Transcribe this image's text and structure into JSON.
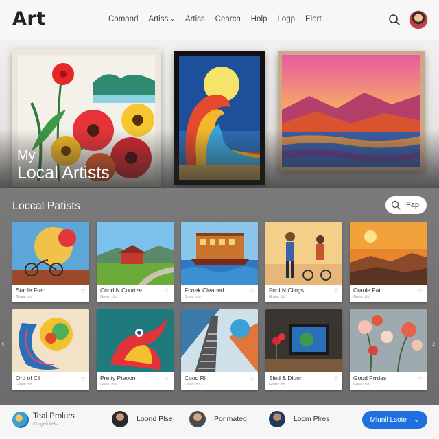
{
  "header": {
    "logo": "Art",
    "nav": [
      {
        "label": "Comand"
      },
      {
        "label": "Artiss",
        "has_dropdown": true
      },
      {
        "label": "Artiss"
      },
      {
        "label": "Cearch"
      },
      {
        "label": "Holp"
      },
      {
        "label": "Logp"
      },
      {
        "label": "Elort"
      }
    ],
    "search_icon": "search-icon",
    "avatar": "user-avatar"
  },
  "hero": {
    "title_line1": "My",
    "title_line2": "Local Artists",
    "artworks": [
      "flowers-painting",
      "wave-moon-painting",
      "sunset-mountains-painting"
    ]
  },
  "section": {
    "title": "Loccal Patists",
    "filter_label": "Fap",
    "cards": [
      {
        "title": "Stacle Fred",
        "subtitle": "Gnea: clo"
      },
      {
        "title": "Cood N Courtze",
        "subtitle": "Gnea: clo"
      },
      {
        "title": "Fooek Cleaned",
        "subtitle": "Gnea: clo"
      },
      {
        "title": "Fnol N Cilogs",
        "subtitle": "Gnea: clo"
      },
      {
        "title": "Craole Fat",
        "subtitle": "Gnea: clo"
      },
      {
        "title": "Ord of Cil",
        "subtitle": "Gnea: clo"
      },
      {
        "title": "Pretty Pteoon",
        "subtitle": "Gnea: clo"
      },
      {
        "title": "Cood Ril",
        "subtitle": "Gnea: clo"
      },
      {
        "title": "Sied & Diuon",
        "subtitle": "Gnea: clo"
      },
      {
        "title": "Good Prrdes",
        "subtitle": "Gnea: clo"
      }
    ]
  },
  "bottom": {
    "brand_title": "Teal Prolurs",
    "brand_sub": "Cmgeil ilels",
    "users": [
      {
        "label": "Loond Plse"
      },
      {
        "label": "Porlmated"
      },
      {
        "label": "Locm Plres"
      }
    ],
    "cta_label": "Miunil Lsote"
  },
  "colors": {
    "accent": "#1f6fe0",
    "section_bg": "#747474"
  }
}
